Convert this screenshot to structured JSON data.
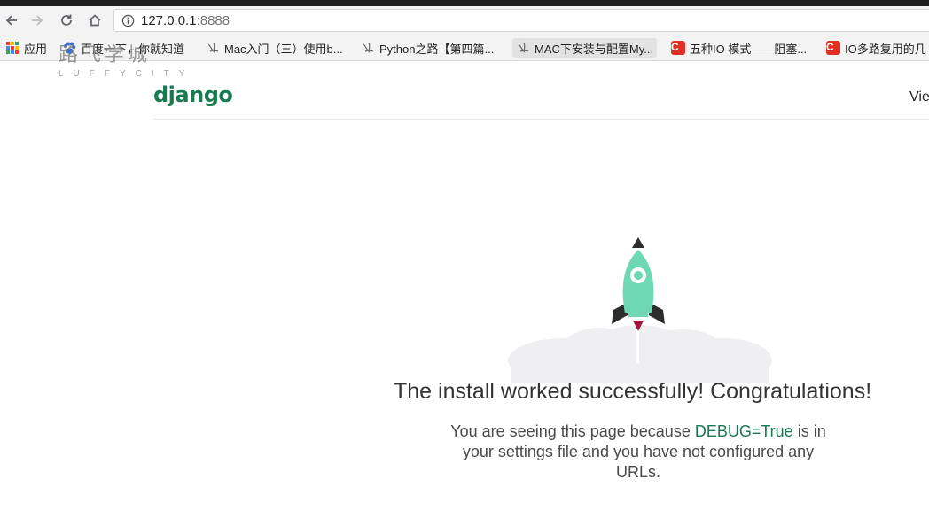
{
  "browser": {
    "url_host": "127.0.0.1",
    "url_port": ":8888"
  },
  "bookmarks": [
    {
      "label": "应用",
      "icon": "apps-grid-icon"
    },
    {
      "label": "百度一下，你就知道",
      "icon": "baidu-paw-icon"
    },
    {
      "label": "Mac入门（三）使用b...",
      "icon": "jianshu-icon"
    },
    {
      "label": "Python之路【第四篇...",
      "icon": "jianshu-icon"
    },
    {
      "label": "MAC下安装与配置My...",
      "icon": "jianshu-icon"
    },
    {
      "label": "五种IO 模式——阻塞...",
      "icon": "csdn-icon"
    },
    {
      "label": "IO多路复用的几",
      "icon": "csdn-icon"
    }
  ],
  "watermark": {
    "cn": "路飞学城",
    "en": "LUFFYCITY"
  },
  "page": {
    "logo": "django",
    "nav_link": "Vie",
    "title": "The install worked successfully! Congratulations!",
    "msg_pre": "You are seeing this page because ",
    "msg_debug": "DEBUG=True",
    "msg_post": " is in your settings file and you have not configured any URLs."
  },
  "colors": {
    "django_green": "#197a4f",
    "rocket_body": "#6dd8b3",
    "csdn_red": "#e02e24"
  }
}
